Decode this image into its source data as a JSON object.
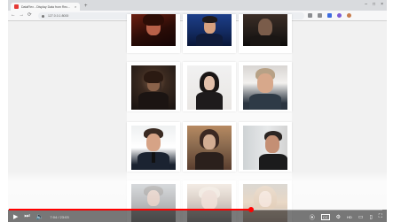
{
  "browser": {
    "tab_title": "DataFlex - Display Data from Rec...",
    "tab_close": "×",
    "newtab": "+",
    "controls": [
      "–",
      "□",
      "×"
    ],
    "url": "127.0.0.1:8000",
    "nav_icons": [
      "back-icon",
      "forward-icon",
      "refresh-icon"
    ],
    "extension_icons": [
      "share-icon",
      "bookmark-icon",
      "extension-icon",
      "profile-icon",
      "menu-icon"
    ]
  },
  "video": {
    "current_time": "7:04 / 23:03",
    "progress_fraction": 0.648,
    "left_controls": [
      "play-icon",
      "next-icon",
      "volume-icon"
    ],
    "right_controls": [
      "autoplay-icon",
      "subtitles-icon",
      "settings-icon",
      "miniplayer-icon",
      "theater-icon",
      "fullscreen-icon"
    ],
    "cc_label": "CC",
    "hd_label": "HD"
  },
  "gallery": {
    "photos": [
      {
        "name": "photo-1",
        "alt": "portrait-photo"
      },
      {
        "name": "photo-2",
        "alt": "portrait-photo"
      },
      {
        "name": "photo-3",
        "alt": "portrait-photo"
      },
      {
        "name": "photo-4",
        "alt": "portrait-photo"
      },
      {
        "name": "photo-5",
        "alt": "portrait-photo"
      },
      {
        "name": "photo-6",
        "alt": "portrait-photo"
      },
      {
        "name": "photo-7",
        "alt": "portrait-photo"
      },
      {
        "name": "photo-8",
        "alt": "portrait-photo"
      },
      {
        "name": "photo-9",
        "alt": "portrait-photo"
      },
      {
        "name": "photo-10",
        "alt": "portrait-photo"
      },
      {
        "name": "photo-11",
        "alt": "portrait-photo"
      },
      {
        "name": "photo-12",
        "alt": "portrait-photo"
      }
    ]
  },
  "colors": {
    "accent": "#ff0000",
    "background": "#f1f1f1",
    "card": "#ffffff"
  }
}
